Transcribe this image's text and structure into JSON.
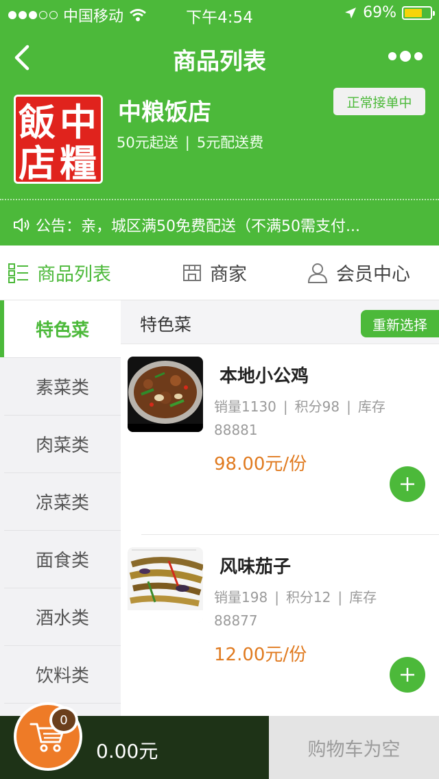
{
  "status_bar": {
    "carrier": "中国移动",
    "time": "下午4:54",
    "battery": "69%",
    "battery_level": 0.69
  },
  "nav": {
    "title": "商品列表"
  },
  "shop": {
    "logo_text": [
      "飯",
      "中",
      "店",
      "糧"
    ],
    "name": "中粮饭店",
    "min_order": "50元起送",
    "delivery_fee": "5元配送费",
    "meta_separator": "|",
    "status_badge": "正常接单中",
    "notice": "公告：亲，城区满50免费配送（不满50需支付..."
  },
  "tabs": [
    {
      "label": "商品列表",
      "icon": "list-icon",
      "active": true
    },
    {
      "label": "商家",
      "icon": "store-icon",
      "active": false
    },
    {
      "label": "会员中心",
      "icon": "user-icon",
      "active": false
    }
  ],
  "categories": [
    {
      "label": "特色菜",
      "active": true
    },
    {
      "label": "素菜类",
      "active": false
    },
    {
      "label": "肉菜类",
      "active": false
    },
    {
      "label": "凉菜类",
      "active": false
    },
    {
      "label": "面食类",
      "active": false
    },
    {
      "label": "酒水类",
      "active": false
    },
    {
      "label": "饮料类",
      "active": false
    }
  ],
  "section": {
    "title": "特色菜",
    "reselect_label": "重新选择"
  },
  "products": [
    {
      "name": "本地小公鸡",
      "sales": "销量1130",
      "points": "积分98",
      "stock_label": "库存",
      "stock_value": "88881",
      "price": "98.00元/份"
    },
    {
      "name": "风味茄子",
      "sales": "销量198",
      "points": "积分12",
      "stock_label": "库存",
      "stock_value": "88877",
      "price": "12.00元/份"
    }
  ],
  "cart": {
    "count": "0",
    "total": "0.00元",
    "status": "购物车为空"
  },
  "colors": {
    "brand_green": "#4cb93a",
    "price_orange": "#e07a1f",
    "cart_orange": "#ee7b27",
    "cart_dark": "#1e3317"
  }
}
